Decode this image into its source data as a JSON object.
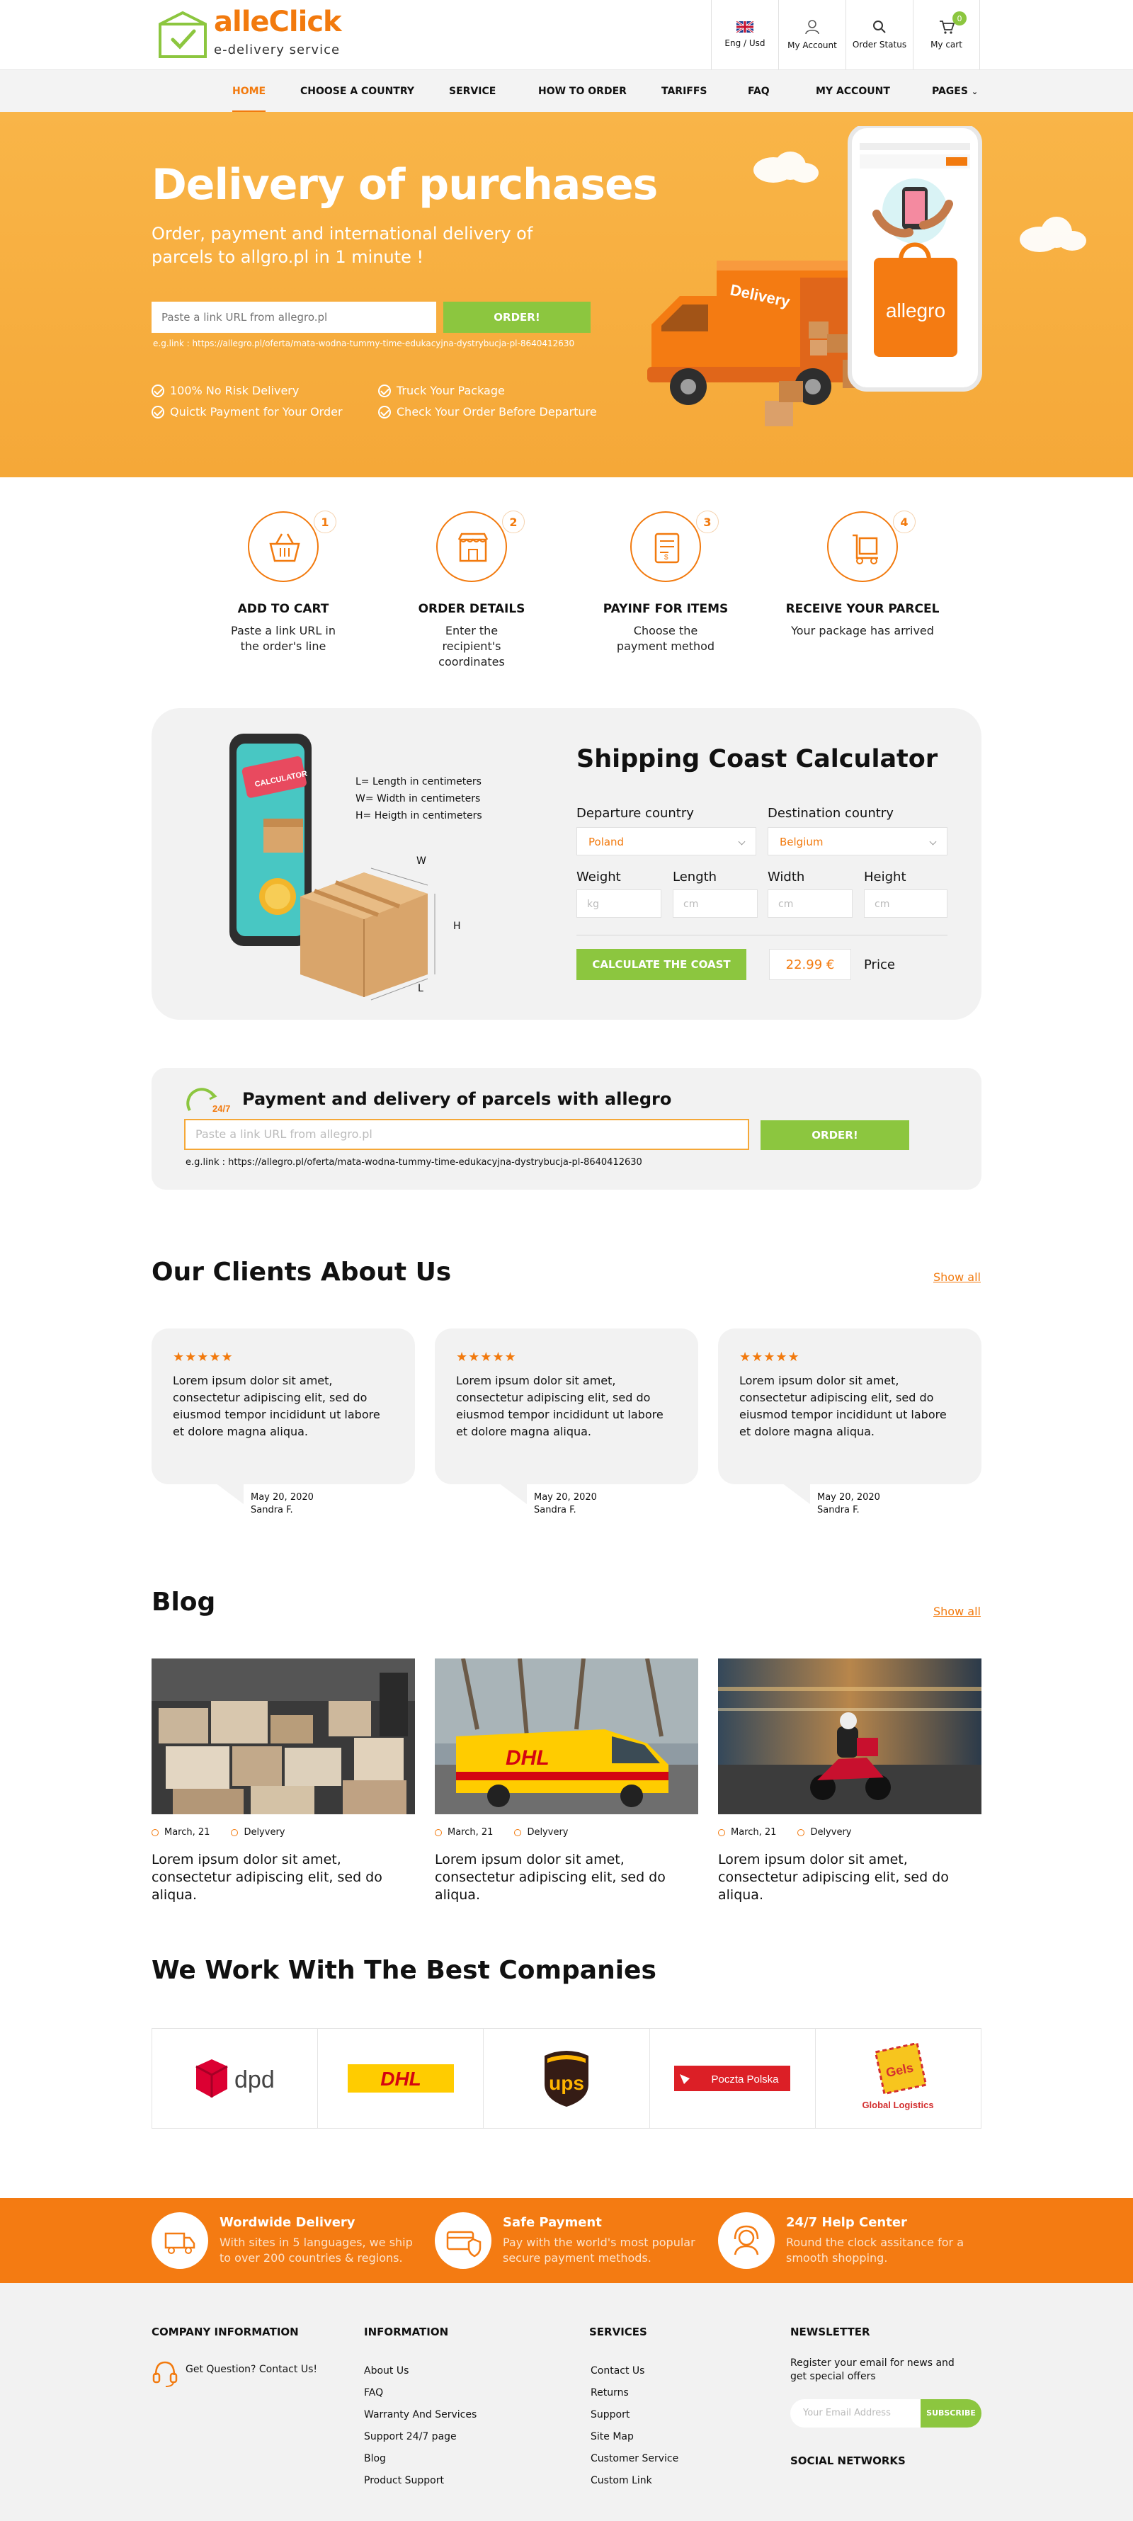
{
  "header": {
    "logo_name": "alleClick",
    "logo_sub": "e-delivery service",
    "actions": [
      {
        "label": "Eng / Usd",
        "icon": "uk-flag-icon"
      },
      {
        "label": "My Account",
        "icon": "user-icon"
      },
      {
        "label": "Order Status",
        "icon": "search-icon"
      },
      {
        "label": "My cart",
        "icon": "cart-icon"
      }
    ],
    "cart_count": "0"
  },
  "nav": {
    "items": [
      "HOME",
      "CHOOSE A COUNTRY",
      "SERVICE",
      "HOW TO ORDER",
      "TARIFFS",
      "FAQ",
      "MY ACCOUNT",
      "PAGES"
    ]
  },
  "hero": {
    "title": "Delivery of purchases",
    "subtitle": "Order, payment and international delivery of parcels to allgro.pl  in 1 minute !",
    "input_placeholder": "Paste a link URL from allegro.pl",
    "button": "ORDER!",
    "example": "e.g.link : https://allegro.pl/oferta/mata-wodna-tummy-time-edukacyjna-dystrybucja-pl-8640412630",
    "checks": [
      "100% No Risk Delivery",
      "Truck Your Package",
      "Quictk Payment for Your Order",
      "Check Your Order Before Departure"
    ],
    "phone_brand": "allegro"
  },
  "steps": [
    {
      "num": "1",
      "title": "ADD TO CART",
      "desc": "Paste a link URL in the order's line",
      "icon": "basket-icon"
    },
    {
      "num": "2",
      "title": "ORDER DETAILS",
      "desc": "Enter the recipient's coordinates",
      "icon": "shop-icon"
    },
    {
      "num": "3",
      "title": "PAYINF FOR ITEMS",
      "desc": "Choose the payment method",
      "icon": "payment-icon"
    },
    {
      "num": "4",
      "title": "RECEIVE YOUR PARCEL",
      "desc": "Your package has arrived",
      "icon": "parcel-trolley-icon"
    }
  ],
  "calculator": {
    "title": "Shipping Coast Calculator",
    "legend": [
      "L= Length in centimeters",
      "W= Width in centimeters",
      "H= Heigth in centimeters"
    ],
    "phone_label": "CALCULATOR",
    "dims": [
      "W",
      "H",
      "L"
    ],
    "departure_label": "Departure country",
    "departure_value": "Poland",
    "destination_label": "Destination country",
    "destination_value": "Belgium",
    "weight_label": "Weight",
    "weight_placeholder": "kg",
    "length_label": "Length",
    "width_label": "Width",
    "height_label": "Height",
    "cm": "cm",
    "button": "CALCULATE THE COAST",
    "price": "22.99  €",
    "price_label": "Price"
  },
  "payment": {
    "badge": "24/7",
    "title": "Payment and delivery of parcels with allegro",
    "input_placeholder": "Paste a link URL from allegro.pl",
    "button": "ORDER!",
    "example": "e.g.link : https://allegro.pl/oferta/mata-wodna-tummy-time-edukacyjna-dystrybucja-pl-8640412630"
  },
  "clients": {
    "title": "Our Clients About Us",
    "show_all": "Show all",
    "reviews": [
      {
        "stars": "★★★★★",
        "text": "Lorem ipsum dolor sit amet, consectetur adipiscing elit, sed do eiusmod tempor incididunt ut labore et dolore magna aliqua.",
        "date": "May 20, 2020",
        "author": "Sandra F."
      },
      {
        "stars": "★★★★★",
        "text": "Lorem ipsum dolor sit amet, consectetur adipiscing elit, sed do eiusmod tempor incididunt ut labore et dolore magna aliqua.",
        "date": "May 20, 2020",
        "author": "Sandra F."
      },
      {
        "stars": "★★★★★",
        "text": "Lorem ipsum dolor sit amet, consectetur adipiscing elit, sed do eiusmod tempor incididunt ut labore et dolore magna aliqua.",
        "date": "May 20, 2020",
        "author": "Sandra F."
      }
    ]
  },
  "blog": {
    "title": "Blog",
    "show_all": "Show all",
    "posts": [
      {
        "date": "March, 21",
        "tag": "Delyvery",
        "text": "Lorem ipsum dolor sit amet, consectetur adipiscing elit, sed do  aliqua.",
        "image": "warehouse-boxes"
      },
      {
        "date": "March, 21",
        "tag": "Delyvery",
        "text": "Lorem ipsum dolor sit amet, consectetur adipiscing elit, sed do  aliqua.",
        "image": "dhl-van"
      },
      {
        "date": "March, 21",
        "tag": "Delyvery",
        "text": "Lorem ipsum dolor sit amet, consectetur adipiscing elit, sed do  aliqua.",
        "image": "courier-scooter"
      }
    ]
  },
  "partners": {
    "title": "We Work With The Best Companies",
    "logos": [
      "dpd",
      "DHL",
      "ups",
      "Poczta Polska",
      "Gels",
      "Global Logistics"
    ]
  },
  "features": [
    {
      "title": "Wordwide Delivery",
      "desc": "With sites in 5 languages, we ship to over 200 countries & regions.",
      "icon": "delivery-truck-icon"
    },
    {
      "title": "Safe Payment",
      "desc": "Pay with the world's most popular secure payment methods.",
      "icon": "secure-payment-icon"
    },
    {
      "title": "24/7 Help Center",
      "desc": "Round the clock assitance for a smooth shopping.",
      "icon": "headset-icon"
    }
  ],
  "footer": {
    "company_heading": "COMPANY INFORMATION",
    "company_contact": "Get Question? Contact Us!",
    "info_heading": "INFORMATION",
    "info_links": [
      "About Us",
      "FAQ",
      "Warranty And Services",
      "Support 24/7 page",
      "Blog",
      "Product Support"
    ],
    "services_heading": "SERVICES",
    "services_links": [
      "Contact Us",
      "Returns",
      "Support",
      "Site Map",
      "Customer Service",
      "Custom Link"
    ],
    "newsletter_heading": "NEWSLETTER",
    "newsletter_text": "Register your email for news and get special offers",
    "newsletter_placeholder": "Your Email Address",
    "newsletter_button": "SUBSCRIBE",
    "social_heading": "SOCIAL NETWORKS"
  },
  "colors": {
    "accent": "#f27a0e",
    "green": "#8cc63f",
    "hero": "#f5a838"
  }
}
